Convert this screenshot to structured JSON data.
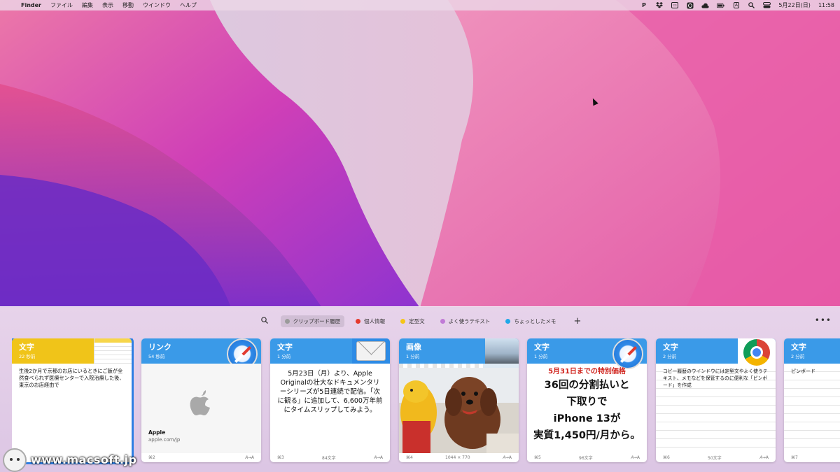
{
  "menubar": {
    "app": "Finder",
    "menus": [
      "ファイル",
      "編集",
      "表示",
      "移動",
      "ウインドウ",
      "ヘルプ"
    ],
    "date": "5月22日(日)",
    "time": "11:58",
    "tray_a": "A"
  },
  "toolbar": {
    "tabs": [
      {
        "label": "クリップボード履歴",
        "color": "#9a9a9a"
      },
      {
        "label": "個人情報",
        "color": "#e5392d"
      },
      {
        "label": "定型文",
        "color": "#f5c518"
      },
      {
        "label": "よく使うテキスト",
        "color": "#c07ad6"
      },
      {
        "label": "ちょっとしたメモ",
        "color": "#1fa8e8"
      }
    ],
    "add": "+",
    "more": "•••"
  },
  "cards": [
    {
      "type": "文字",
      "time": "22 秒前",
      "color": "#f0c419",
      "body": "生後2か月で京都のお店にいるときにご飯が全然食べられず医療センターで入院治療した後、東京のお店経由で",
      "shortcut": "",
      "count": "",
      "fmt": ""
    },
    {
      "type": "リンク",
      "time": "54 秒前",
      "color": "#3a9ae8",
      "link_title": "Apple",
      "link_url": "apple.com/jp",
      "shortcut": "⌘2",
      "count": "",
      "fmt": "𝐴→A"
    },
    {
      "type": "文字",
      "time": "1 分前",
      "color": "#3a9ae8",
      "body": "5月23日（月）より、Apple Originalの壮大なドキュメンタリーシリーズが5日連続で配信。「次に観る」に追加して、6,600万年前にタイムスリップしてみよう。",
      "shortcut": "⌘3",
      "count": "84文字",
      "fmt": "𝐴→A"
    },
    {
      "type": "画像",
      "time": "1 分前",
      "color": "#3a9ae8",
      "shortcut": "⌘4",
      "count": "1044 × 770",
      "fmt": "𝐴→A"
    },
    {
      "type": "文字",
      "time": "1 分前",
      "color": "#3a9ae8",
      "sale_head": "5月31日までの特別価格",
      "sale_lines": [
        "36回の分割払いと",
        "下取りで",
        "iPhone 13が",
        "実質1,450円/月から。"
      ],
      "shortcut": "⌘5",
      "count": "96文字",
      "fmt": "𝐴→A"
    },
    {
      "type": "文字",
      "time": "2 分前",
      "color": "#3a9ae8",
      "body": "コピー履歴のウインドウには定型文やよく使うテキスト、メモなどを保管するのに便利な「ピンボード」を作成",
      "shortcut": "⌘6",
      "count": "50文字",
      "fmt": "𝐴→A"
    },
    {
      "type": "文字",
      "time": "2 分前",
      "color": "#3a9ae8",
      "body": "ピンボード",
      "shortcut": "⌘7",
      "count": "",
      "fmt": ""
    }
  ],
  "watermark": "www.macsoft.jp"
}
